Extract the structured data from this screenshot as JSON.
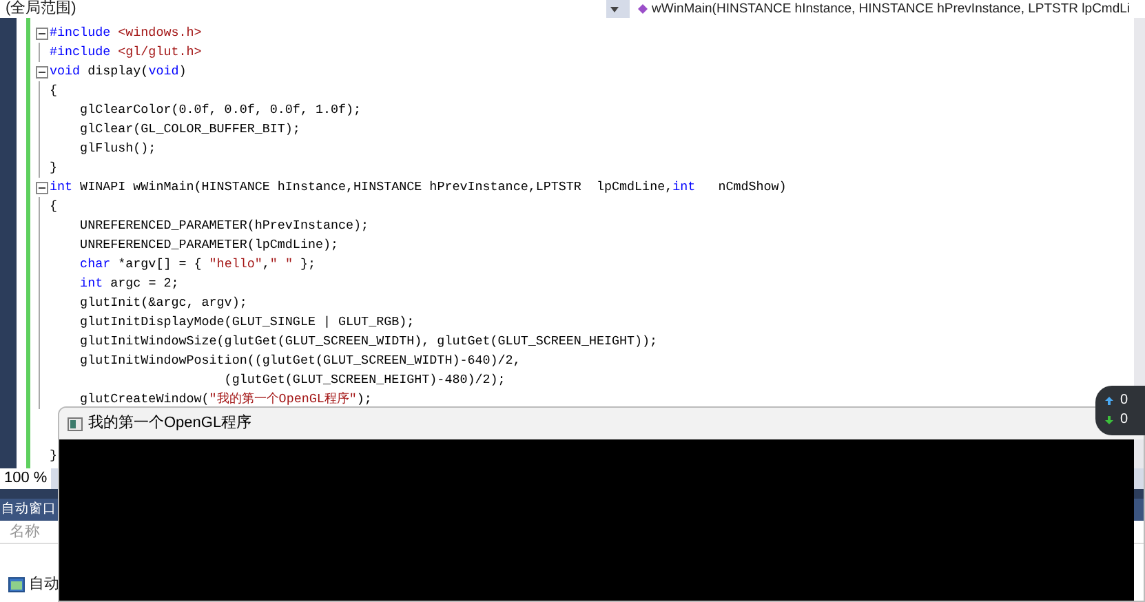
{
  "toolbar": {
    "scope_dropdown": "(全局范围)",
    "member_dropdown": "wWinMain(HINSTANCE hInstance, HINSTANCE hPrevInstance, LPTSTR lpCmdLi"
  },
  "code_lines": [
    {
      "fold": true,
      "tokens": [
        {
          "kind": "preproc",
          "text": "#include "
        },
        {
          "kind": "string",
          "text": "<windows.h>"
        }
      ]
    },
    {
      "fold": false,
      "tokens": [
        {
          "kind": "preproc",
          "text": "#include "
        },
        {
          "kind": "string",
          "text": "<gl/glut.h>"
        }
      ]
    },
    {
      "fold": true,
      "tokens": [
        {
          "kind": "keyword",
          "text": "void"
        },
        {
          "kind": "plain",
          "text": " display("
        },
        {
          "kind": "keyword",
          "text": "void"
        },
        {
          "kind": "plain",
          "text": ")"
        }
      ]
    },
    {
      "fold": false,
      "tokens": [
        {
          "kind": "plain",
          "text": "{"
        }
      ]
    },
    {
      "fold": false,
      "tokens": [
        {
          "kind": "plain",
          "text": "    glClearColor(0.0f, 0.0f, 0.0f, 1.0f);"
        }
      ]
    },
    {
      "fold": false,
      "tokens": [
        {
          "kind": "plain",
          "text": "    glClear(GL_COLOR_BUFFER_BIT);"
        }
      ]
    },
    {
      "fold": false,
      "tokens": [
        {
          "kind": "plain",
          "text": "    glFlush();"
        }
      ]
    },
    {
      "fold": false,
      "tokens": [
        {
          "kind": "plain",
          "text": "}"
        }
      ]
    },
    {
      "fold": true,
      "tokens": [
        {
          "kind": "keyword",
          "text": "int"
        },
        {
          "kind": "plain",
          "text": " WINAPI wWinMain(HINSTANCE hInstance,HINSTANCE hPrevInstance,LPTSTR  lpCmdLine,"
        },
        {
          "kind": "keyword",
          "text": "int"
        },
        {
          "kind": "plain",
          "text": "   nCmdShow)"
        }
      ]
    },
    {
      "fold": false,
      "tokens": [
        {
          "kind": "plain",
          "text": "{"
        }
      ]
    },
    {
      "fold": false,
      "tokens": [
        {
          "kind": "plain",
          "text": "    UNREFERENCED_PARAMETER(hPrevInstance);"
        }
      ]
    },
    {
      "fold": false,
      "tokens": [
        {
          "kind": "plain",
          "text": "    UNREFERENCED_PARAMETER(lpCmdLine);"
        }
      ]
    },
    {
      "fold": false,
      "tokens": [
        {
          "kind": "keyword",
          "text": "    char"
        },
        {
          "kind": "plain",
          "text": " *argv[] = { "
        },
        {
          "kind": "string",
          "text": "\"hello\""
        },
        {
          "kind": "plain",
          "text": ","
        },
        {
          "kind": "string",
          "text": "\" \""
        },
        {
          "kind": "plain",
          "text": " };"
        }
      ]
    },
    {
      "fold": false,
      "tokens": [
        {
          "kind": "keyword",
          "text": "    int"
        },
        {
          "kind": "plain",
          "text": " argc = 2;"
        }
      ]
    },
    {
      "fold": false,
      "tokens": [
        {
          "kind": "plain",
          "text": "    glutInit(&argc, argv);"
        }
      ]
    },
    {
      "fold": false,
      "tokens": [
        {
          "kind": "plain",
          "text": "    glutInitDisplayMode(GLUT_SINGLE | GLUT_RGB);"
        }
      ]
    },
    {
      "fold": false,
      "tokens": [
        {
          "kind": "plain",
          "text": "    glutInitWindowSize(glutGet(GLUT_SCREEN_WIDTH), glutGet(GLUT_SCREEN_HEIGHT));"
        }
      ]
    },
    {
      "fold": false,
      "tokens": [
        {
          "kind": "plain",
          "text": "    glutInitWindowPosition((glutGet(GLUT_SCREEN_WIDTH)-640)/2,"
        }
      ]
    },
    {
      "fold": false,
      "tokens": [
        {
          "kind": "plain",
          "text": "                       (glutGet(GLUT_SCREEN_HEIGHT)-480)/2);"
        }
      ]
    },
    {
      "fold": false,
      "tokens": [
        {
          "kind": "plain",
          "text": "    glutCreateWindow("
        },
        {
          "kind": "string",
          "text": "\"我的第一个OpenGL程序\""
        },
        {
          "kind": "plain",
          "text": ");"
        }
      ]
    }
  ],
  "closing_brace": "}",
  "zoom_level": "100 %",
  "autos_panel": {
    "title": "自动窗口",
    "column_header": "名称",
    "tab": "自动"
  },
  "glut_window": {
    "title": "我的第一个OpenGL程序"
  },
  "network_widget": {
    "upload": "0",
    "download": "0"
  }
}
